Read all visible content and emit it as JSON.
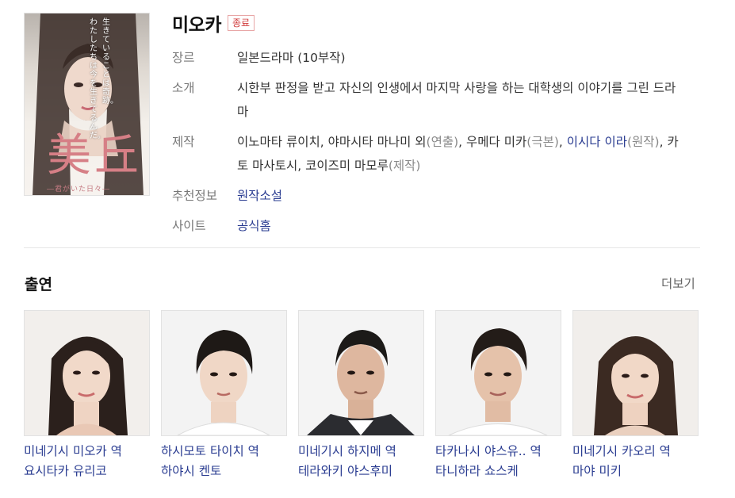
{
  "title": "미오카",
  "status_badge": "종료",
  "poster": {
    "calligraphy": "美丘",
    "subtitle": "―君がいた日々―",
    "vertical_lines": [
      "生きていることは奇跡。",
      "わたしたちは今を生きてるんだ。"
    ]
  },
  "info": {
    "genre": {
      "label": "장르",
      "value": "일본드라마 (10부작)"
    },
    "intro": {
      "label": "소개",
      "value": "시한부 판정을 받고 자신의 인생에서 마지막 사랑을 하는 대학생의 이야기를 그린 드라마"
    },
    "production": {
      "label": "제작",
      "parts": [
        {
          "text": "이노마타 류이치",
          "type": "text"
        },
        {
          "text": ", ",
          "type": "text"
        },
        {
          "text": "야마시타 마나미",
          "type": "text"
        },
        {
          "text": " 외",
          "type": "text"
        },
        {
          "text": "(연출)",
          "type": "paren"
        },
        {
          "text": ", ",
          "type": "text"
        },
        {
          "text": "우메다 미카",
          "type": "text"
        },
        {
          "text": "(극본)",
          "type": "paren"
        },
        {
          "text": ", ",
          "type": "text"
        },
        {
          "text": "이시다 이라",
          "type": "link"
        },
        {
          "text": "(원작)",
          "type": "paren"
        },
        {
          "text": ", ",
          "type": "text"
        },
        {
          "text": "카토 마사토시",
          "type": "text"
        },
        {
          "text": ", ",
          "type": "text"
        },
        {
          "text": "코이즈미 마모루",
          "type": "text"
        },
        {
          "text": "(제작)",
          "type": "paren"
        }
      ]
    },
    "recommend": {
      "label": "추천정보",
      "value": "원작소설"
    },
    "site": {
      "label": "사이트",
      "value": "공식홈"
    }
  },
  "cast_section": {
    "title": "출연",
    "more": "더보기"
  },
  "cast": [
    {
      "role": "미네기시 미오카 역",
      "actor": "요시타카 유리코"
    },
    {
      "role": "하시모토 타이치 역",
      "actor": "하야시 켄토"
    },
    {
      "role": "미네기시 하지메 역",
      "actor": "테라와키 야스후미"
    },
    {
      "role": "타카나시 야스유.. 역",
      "actor": "타니하라 쇼스케"
    },
    {
      "role": "미네기시 카오리 역",
      "actor": "마야 미키"
    }
  ]
}
